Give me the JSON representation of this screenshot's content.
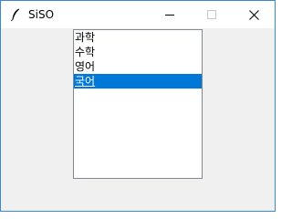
{
  "window": {
    "title": "SiSO",
    "accent_color": "#3c87d0"
  },
  "listbox": {
    "items": [
      {
        "label": "과학",
        "selected": false
      },
      {
        "label": "수학",
        "selected": false
      },
      {
        "label": "영어",
        "selected": false
      },
      {
        "label": "국어",
        "selected": true
      }
    ],
    "selected_color": "#0078d7"
  }
}
